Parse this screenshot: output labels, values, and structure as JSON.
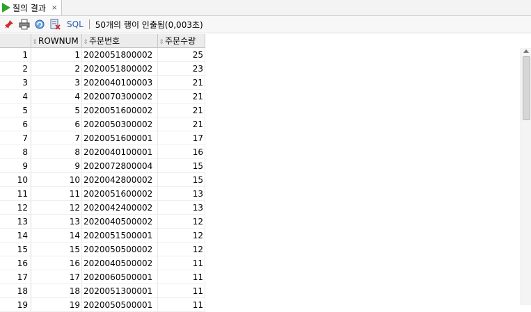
{
  "tab": {
    "title": "질의 결과",
    "close": "×"
  },
  "toolbar": {
    "icons": [
      "pin-icon",
      "print-icon",
      "refresh-icon",
      "export-icon"
    ],
    "sql_label": "SQL",
    "status": "50개의 행이 인출됨(0,003초)"
  },
  "grid": {
    "columns": [
      "ROWNUM",
      "주문번호",
      "주문수량"
    ],
    "rows": [
      {
        "idx": "1",
        "rownum": "1",
        "order_no": "2020051800002",
        "qty": "25"
      },
      {
        "idx": "2",
        "rownum": "2",
        "order_no": "2020051800002",
        "qty": "23"
      },
      {
        "idx": "3",
        "rownum": "3",
        "order_no": "2020040100003",
        "qty": "21"
      },
      {
        "idx": "4",
        "rownum": "4",
        "order_no": "2020070300002",
        "qty": "21"
      },
      {
        "idx": "5",
        "rownum": "5",
        "order_no": "2020051600002",
        "qty": "21"
      },
      {
        "idx": "6",
        "rownum": "6",
        "order_no": "2020050300002",
        "qty": "21"
      },
      {
        "idx": "7",
        "rownum": "7",
        "order_no": "2020051600001",
        "qty": "17"
      },
      {
        "idx": "8",
        "rownum": "8",
        "order_no": "2020040100001",
        "qty": "16"
      },
      {
        "idx": "9",
        "rownum": "9",
        "order_no": "2020072800004",
        "qty": "15"
      },
      {
        "idx": "10",
        "rownum": "10",
        "order_no": "2020042800002",
        "qty": "15"
      },
      {
        "idx": "11",
        "rownum": "11",
        "order_no": "2020051600002",
        "qty": "13"
      },
      {
        "idx": "12",
        "rownum": "12",
        "order_no": "2020042400002",
        "qty": "13"
      },
      {
        "idx": "13",
        "rownum": "13",
        "order_no": "2020040500002",
        "qty": "12"
      },
      {
        "idx": "14",
        "rownum": "14",
        "order_no": "2020051500001",
        "qty": "12"
      },
      {
        "idx": "15",
        "rownum": "15",
        "order_no": "2020050500002",
        "qty": "12"
      },
      {
        "idx": "16",
        "rownum": "16",
        "order_no": "2020040500002",
        "qty": "11"
      },
      {
        "idx": "17",
        "rownum": "17",
        "order_no": "2020060500001",
        "qty": "11"
      },
      {
        "idx": "18",
        "rownum": "18",
        "order_no": "2020051300001",
        "qty": "11"
      },
      {
        "idx": "19",
        "rownum": "19",
        "order_no": "2020050500001",
        "qty": "11"
      }
    ]
  }
}
